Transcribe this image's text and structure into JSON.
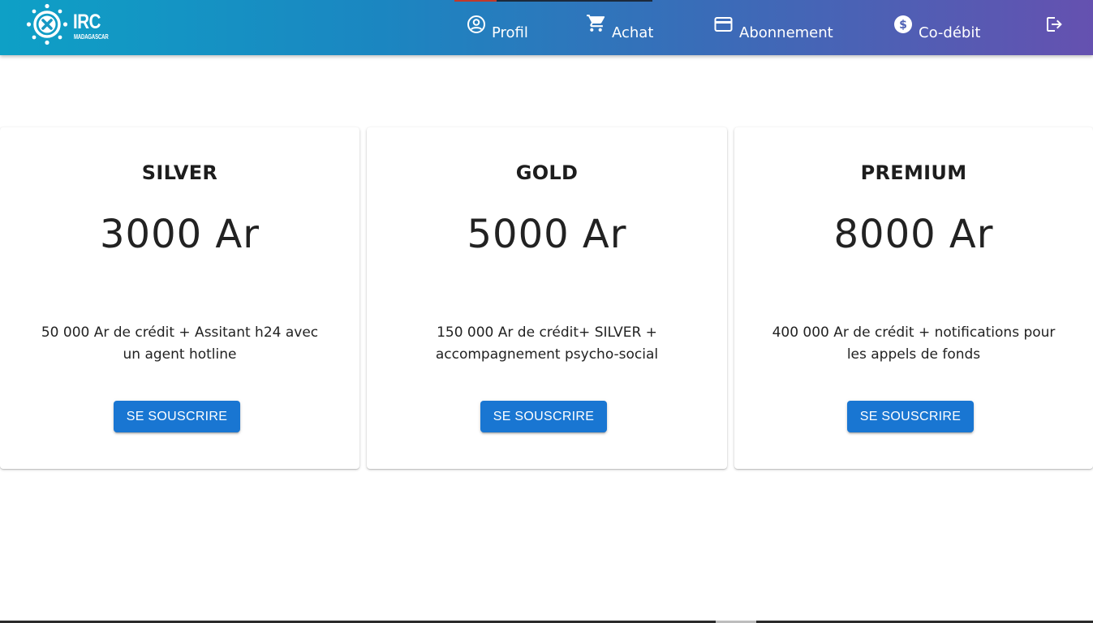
{
  "header": {
    "logo": {
      "text": "IRC",
      "subtext": "MADAGASCAR"
    },
    "nav": [
      {
        "label": "Profil",
        "icon": "account-circle-icon"
      },
      {
        "label": "Achat",
        "icon": "shopping-cart-icon"
      },
      {
        "label": "Abonnement",
        "icon": "credit-card-icon"
      },
      {
        "label": "Co-débit",
        "icon": "dollar-circle-icon"
      },
      {
        "label": "",
        "icon": "logout-icon"
      }
    ],
    "colors": {
      "gradient_start": "#0ea0c6",
      "gradient_end": "#6551b0"
    }
  },
  "plans": [
    {
      "name": "SILVER",
      "price": "3000 Ar",
      "description": "50 000 Ar de crédit + Assitant h24 avec un agent hotline",
      "button_label": "SE SOUSCRIRE"
    },
    {
      "name": "GOLD",
      "price": "5000 Ar",
      "description": "150 000 Ar de crédit+ SILVER + accompagnement psycho-social",
      "button_label": "SE SOUSCRIRE"
    },
    {
      "name": "PREMIUM",
      "price": "8000 Ar",
      "description": "400 000 Ar de crédit + notifications pour les appels de fonds",
      "button_label": "SE SOUSCRIRE"
    }
  ],
  "colors": {
    "button": "#1976d2"
  }
}
